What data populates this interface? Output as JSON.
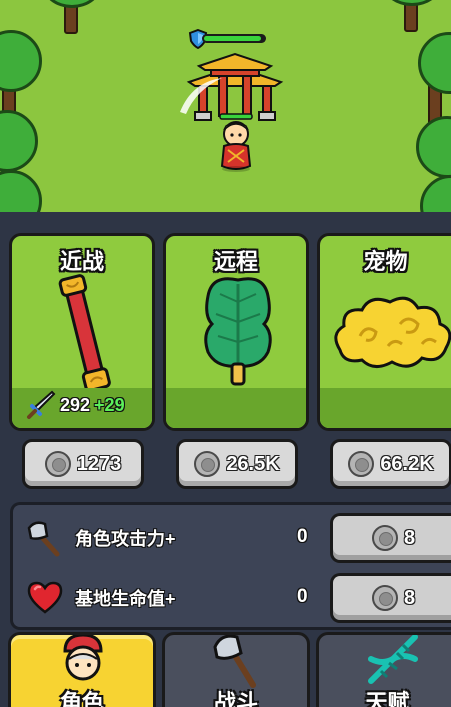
{
  "cards": [
    {
      "title": "近战",
      "icon": "red-staff-icon",
      "stat_value": "292",
      "stat_bonus": "+29",
      "cost": "1273"
    },
    {
      "title": "远程",
      "icon": "green-leaf-icon",
      "cost": "26.5K"
    },
    {
      "title": "宠物",
      "icon": "golden-cloud-icon",
      "cost": "66.2K"
    }
  ],
  "upgrades": [
    {
      "label": "角色攻击力+",
      "icon": "axe-icon",
      "level": "0",
      "cost": "8"
    },
    {
      "label": "基地生命值+",
      "icon": "heart-icon",
      "level": "0",
      "cost": "8"
    }
  ],
  "tabs": [
    {
      "label": "角色",
      "icon": "character-icon",
      "active": true
    },
    {
      "label": "战斗",
      "icon": "battle-axe-icon",
      "active": false
    },
    {
      "label": "天赋",
      "icon": "dna-icon",
      "active": false
    }
  ],
  "scene": {
    "shield_hp_fraction": 0.95
  },
  "colors": {
    "grass": "#8cc63f",
    "card_green": "#8fcb3e",
    "active_tab": "#f7d332",
    "panel": "#2e3545",
    "bonus_green": "#5cf05a"
  }
}
